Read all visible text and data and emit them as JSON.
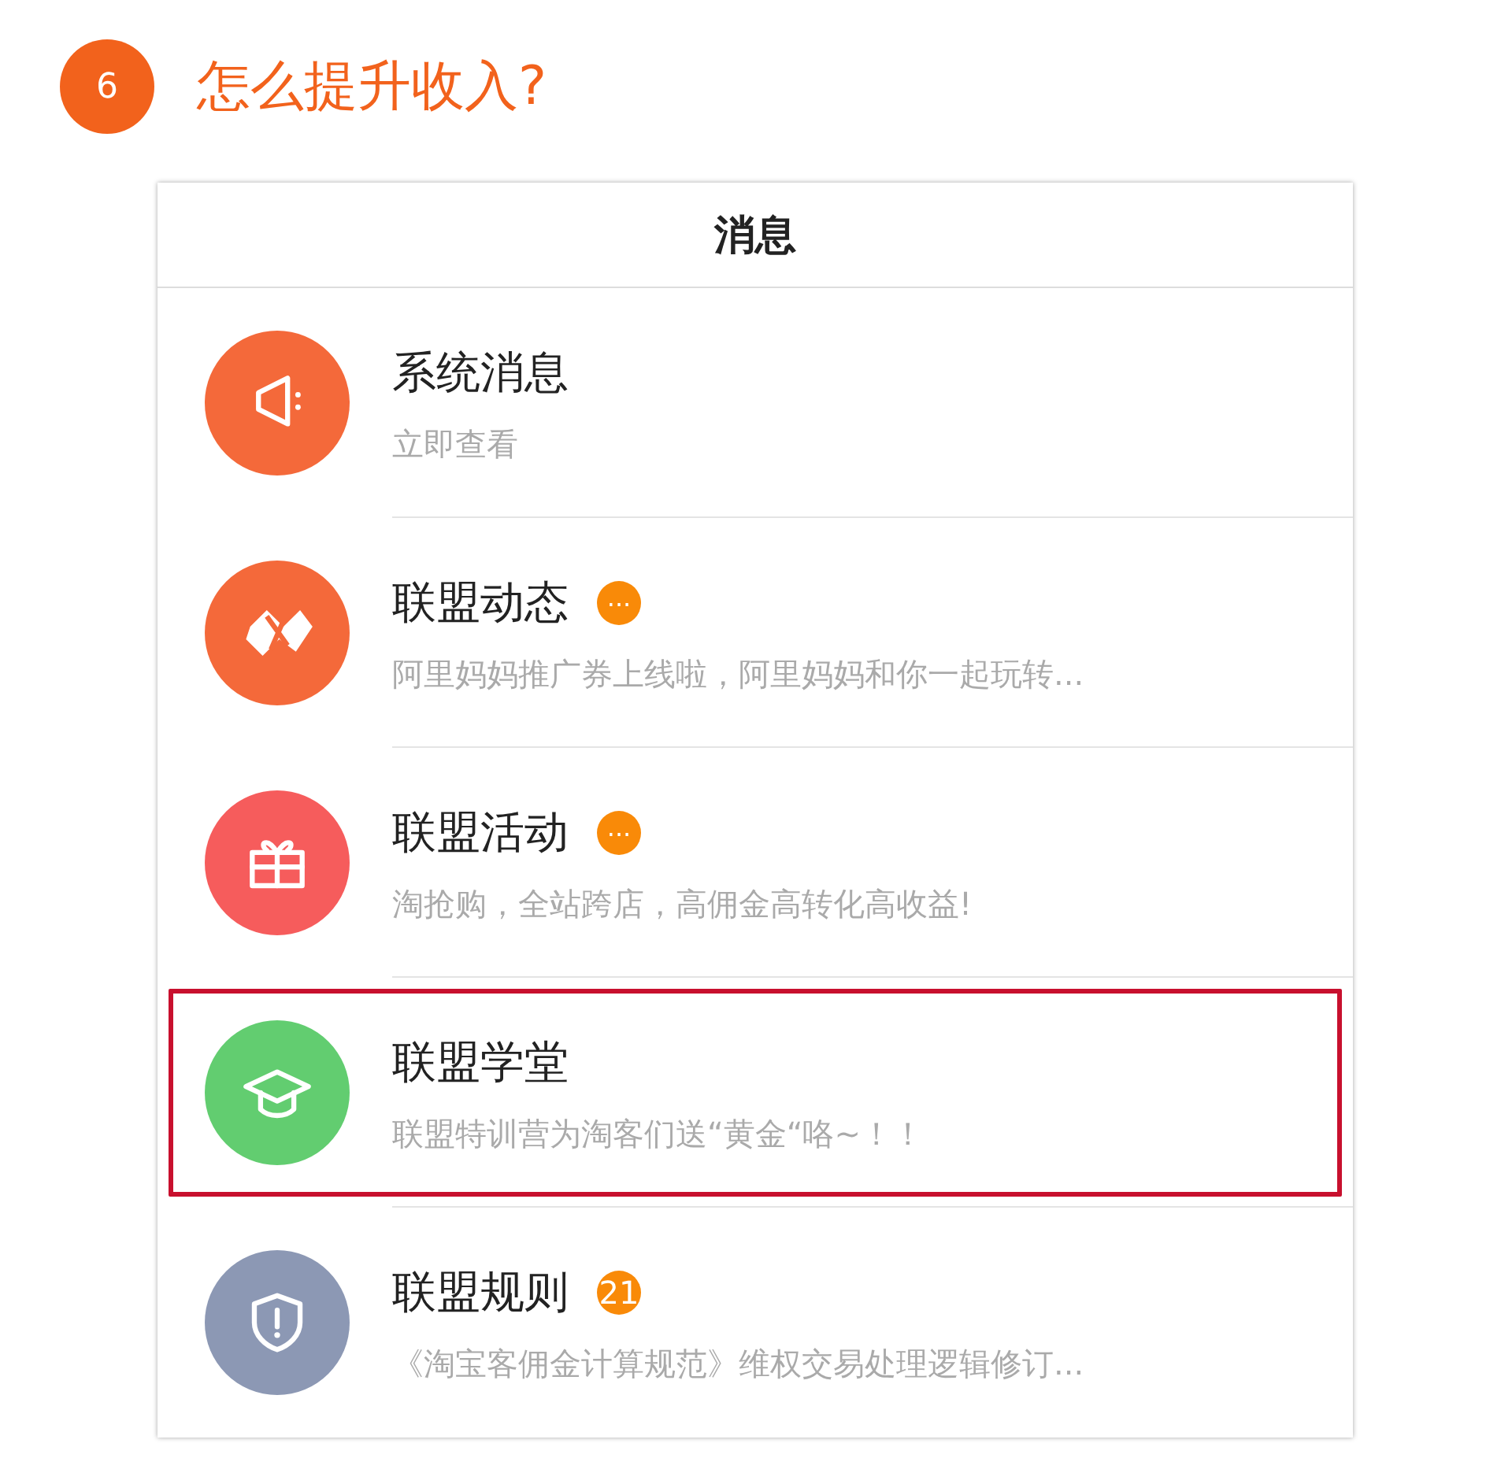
{
  "step": {
    "number": "6",
    "title": "怎么提升收入?"
  },
  "screen": {
    "title": "消息",
    "items": [
      {
        "kind": "megaphone",
        "color": "#f4693a",
        "title": "系统消息",
        "subtitle": "立即查看",
        "highlighted": false
      },
      {
        "kind": "logo",
        "color": "#f4693a",
        "title": "联盟动态",
        "badge": {
          "kind": "dots",
          "text": "..."
        },
        "subtitle": "阿里妈妈推广券上线啦，阿里妈妈和你一起玩转...",
        "highlighted": false
      },
      {
        "kind": "gift",
        "color": "#f65c5c",
        "title": "联盟活动",
        "badge": {
          "kind": "dots",
          "text": "..."
        },
        "subtitle": "淘抢购，全站跨店，高佣金高转化高收益!",
        "highlighted": false
      },
      {
        "kind": "cap",
        "color": "#62cd70",
        "title": "联盟学堂",
        "subtitle": "联盟特训营为淘客们送“黄金“咯~！！",
        "highlighted": true
      },
      {
        "kind": "shield",
        "color": "#8c98b4",
        "title": "联盟规则",
        "badge": {
          "kind": "count",
          "text": "21"
        },
        "subtitle": "《淘宝客佣金计算规范》维权交易处理逻辑修订...",
        "highlighted": false
      }
    ]
  }
}
